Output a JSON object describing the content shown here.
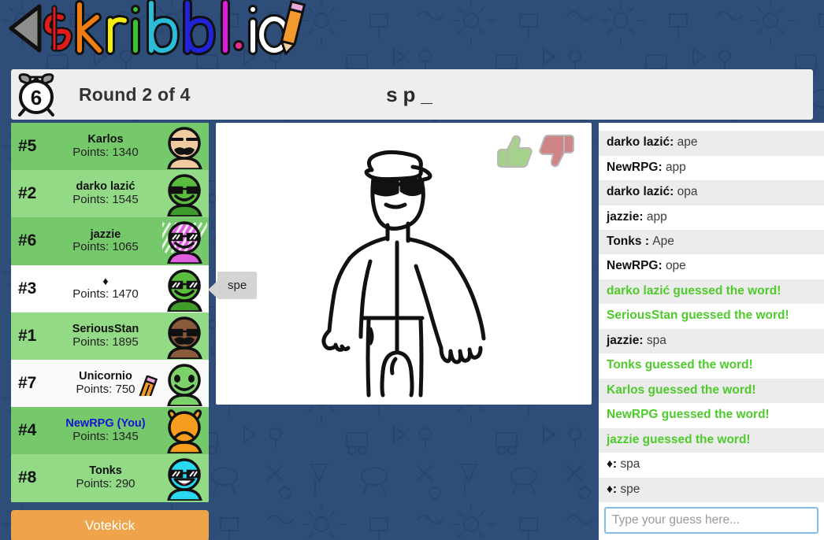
{
  "app": {
    "logo_text": "skribbl.io",
    "background_color": "#2e4d78"
  },
  "topbar": {
    "timer": "6",
    "clock_icon": "alarm-clock-icon",
    "round_label": "Round 2 of 4",
    "word_hint": "sp_"
  },
  "players": {
    "header_hidden": true,
    "rows": [
      {
        "rank": "#5",
        "name": "Karlos",
        "points": "Points: 1340",
        "guessed": true,
        "is_you": false,
        "drawing": false,
        "avatar": {
          "face": "#f0cba0",
          "body": "#f0cba0",
          "eyes": "brows",
          "mouth": "mustache"
        }
      },
      {
        "rank": "#2",
        "name": "darko lazić",
        "points": "Points: 1545",
        "guessed": true,
        "is_you": false,
        "drawing": false,
        "avatar": {
          "face": "#5bbd3f",
          "body": "#3f9c2a",
          "eyes": "sunglasses-dark",
          "mouth": "smile"
        }
      },
      {
        "rank": "#6",
        "name": "jazzie",
        "points": "Points: 1065",
        "guessed": true,
        "is_you": false,
        "drawing": false,
        "avatar": {
          "face": "#e05fe0",
          "body": "#e05fe0",
          "eyes": "sunglasses-shine",
          "mouth": "smile",
          "stripes": true
        }
      },
      {
        "rank": "#3",
        "name": "♦",
        "points": "Points: 1470",
        "guessed": false,
        "is_you": false,
        "drawing": false,
        "avatar": {
          "face": "#5bbd3f",
          "body": "#3f9c2a",
          "eyes": "sunglasses-shine",
          "mouth": "smile"
        }
      },
      {
        "rank": "#1",
        "name": "SeriousStan",
        "points": "Points: 1895",
        "guessed": true,
        "is_you": false,
        "drawing": false,
        "avatar": {
          "face": "#8a5a3c",
          "body": "#8a5a3c",
          "eyes": "sunglasses-dark",
          "mouth": "mustache"
        }
      },
      {
        "rank": "#7",
        "name": "Unicornio",
        "points": "Points: 750",
        "guessed": false,
        "is_you": false,
        "drawing": true,
        "avatar": {
          "face": "#7dd16a",
          "body": "#7dd16a",
          "eyes": "dots",
          "mouth": "smile"
        }
      },
      {
        "rank": "#4",
        "name": "NewRPG (You)",
        "points": "Points: 1345",
        "guessed": true,
        "is_you": true,
        "drawing": false,
        "avatar": {
          "face": "#f79d1e",
          "body": "#f79d1e",
          "eyes": "none",
          "mouth": "frown",
          "antennae": true
        }
      },
      {
        "rank": "#8",
        "name": "Tonks",
        "points": "Points: 290",
        "guessed": true,
        "is_you": false,
        "drawing": false,
        "avatar": {
          "face": "#2ad8f0",
          "body": "#2ad8f0",
          "eyes": "sunglasses-shine",
          "mouth": "open"
        }
      }
    ]
  },
  "votekick": {
    "label": "Votekick"
  },
  "canvas": {
    "drawing_description": "person-with-cap-and-sunglasses",
    "like_icon": "thumbs-up-icon",
    "dislike_icon": "thumbs-down-icon",
    "like_color": "#a5d18a",
    "dislike_color": "#cf8585"
  },
  "speech_bubble": {
    "text": "spe"
  },
  "chat": {
    "messages": [
      {
        "name": "darko lazić",
        "text": "ape",
        "type": "guess",
        "clipped": true
      },
      {
        "name": "NewRPG",
        "text": "app",
        "type": "guess"
      },
      {
        "name": "darko lazić",
        "text": "opa",
        "type": "guess"
      },
      {
        "name": "jazzie",
        "text": "app",
        "type": "guess"
      },
      {
        "name": "Tonks ",
        "text": "Ape",
        "type": "guess"
      },
      {
        "name": "NewRPG",
        "text": "ope",
        "type": "guess"
      },
      {
        "text": "darko lazić guessed the word!",
        "type": "system"
      },
      {
        "text": "SeriousStan guessed the word!",
        "type": "system"
      },
      {
        "name": "jazzie",
        "text": "spa",
        "type": "guess"
      },
      {
        "text": "Tonks guessed the word!",
        "type": "system"
      },
      {
        "text": "Karlos guessed the word!",
        "type": "system"
      },
      {
        "text": "NewRPG guessed the word!",
        "type": "system"
      },
      {
        "text": "jazzie guessed the word!",
        "type": "system"
      },
      {
        "name": "♦",
        "text": "spa",
        "type": "guess"
      },
      {
        "name": "♦",
        "text": "spe",
        "type": "guess"
      }
    ],
    "input_placeholder": "Type your guess here...",
    "input_value": "",
    "guessed_color": "#4ecb2b"
  }
}
